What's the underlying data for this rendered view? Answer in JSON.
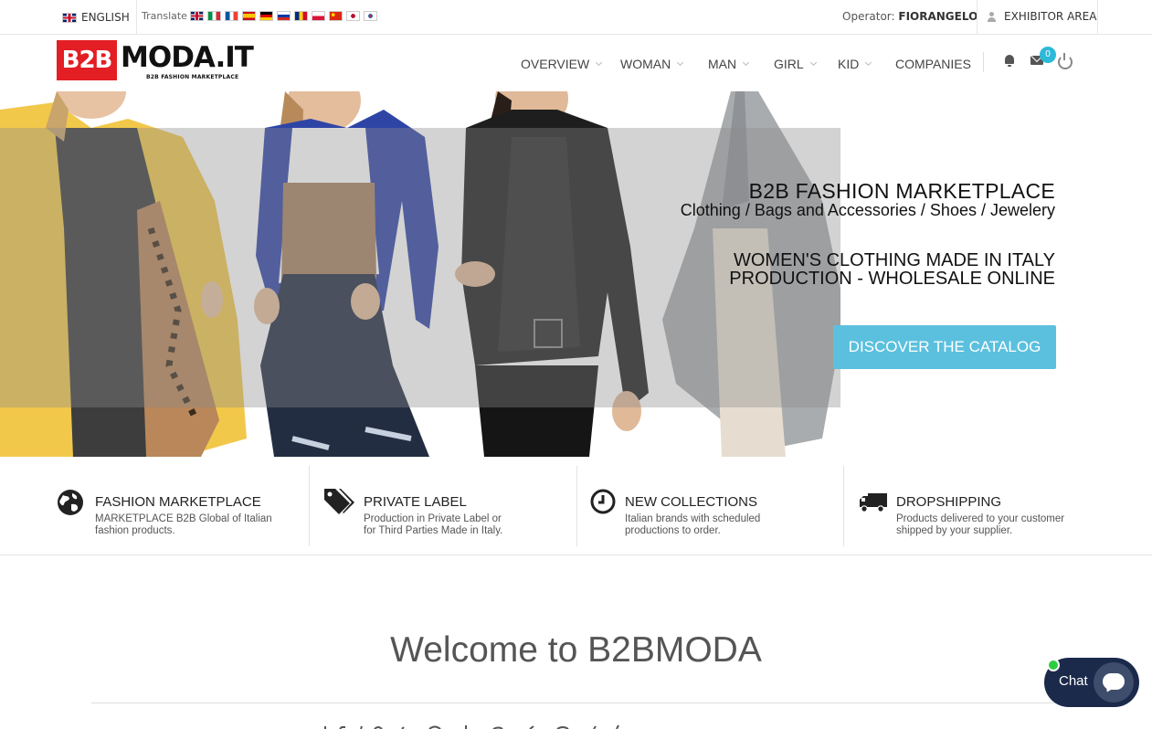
{
  "topbar": {
    "language": "ENGLISH",
    "translate_label": "Translate",
    "flags": [
      "uk-flag-icon",
      "italy-flag-icon",
      "france-flag-icon",
      "spain-flag-icon",
      "germany-flag-icon",
      "russia-flag-icon",
      "romania-flag-icon",
      "poland-flag-icon",
      "china-flag-icon",
      "japan-flag-icon",
      "korea-flag-icon"
    ],
    "operator_label": "Operator:",
    "operator_name": "FIORANGELO",
    "exhibitor_area": "EXHIBITOR AREA"
  },
  "logo": {
    "box_text": "B2B",
    "text": "MODA.IT",
    "subtitle": "B2B FASHION MARKETPLACE",
    "brand_color": "#e31e24"
  },
  "nav": {
    "items": [
      {
        "label": "OVERVIEW",
        "dropdown": true
      },
      {
        "label": "WOMAN",
        "dropdown": true
      },
      {
        "label": "MAN",
        "dropdown": true
      },
      {
        "label": "GIRL",
        "dropdown": true
      },
      {
        "label": "KID",
        "dropdown": true
      },
      {
        "label": "COMPANIES",
        "dropdown": false
      }
    ],
    "mail_badge": "0",
    "accent": "#2db9d8"
  },
  "hero": {
    "title": "B2B FASHION MARKETPLACE",
    "subtitle": "Clothing / Bags and Accessories / Shoes / Jewelery",
    "line1": "WOMEN'S CLOTHING MADE IN ITALY",
    "line2": "PRODUCTION - WHOLESALE ONLINE",
    "cta": "DISCOVER THE CATALOG",
    "cta_color": "#5bc0de"
  },
  "features": [
    {
      "icon": "globe-icon",
      "title": "FASHION MARKETPLACE",
      "desc1": "MARKETPLACE B2B Global of Italian",
      "desc2": "fashion products."
    },
    {
      "icon": "tags-icon",
      "title": "PRIVATE LABEL",
      "desc1": "Production in Private Label or",
      "desc2": "for Third Parties Made in Italy."
    },
    {
      "icon": "clock-icon",
      "title": "NEW COLLECTIONS",
      "desc1": "Italian brands with scheduled",
      "desc2": "productions to order."
    },
    {
      "icon": "truck-icon",
      "title": "DROPSHIPPING",
      "desc1": "Products delivered to your customer",
      "desc2": "shipped by your supplier."
    }
  ],
  "welcome": {
    "title": "Welcome to B2BMODA"
  },
  "chat": {
    "label": "Chat",
    "status_color": "#2ecc40"
  }
}
